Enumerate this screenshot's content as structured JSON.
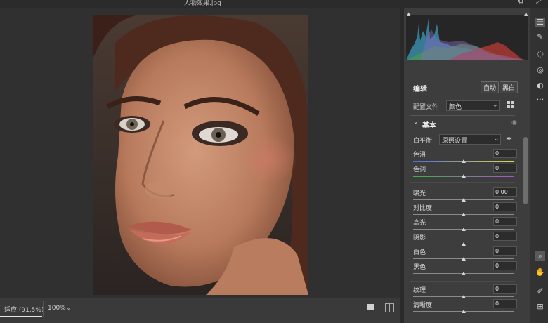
{
  "window": {
    "filename": "人物效果.jpg"
  },
  "canvas": {
    "fit_label": "适应 (91.5%)",
    "zoom_label": "100%",
    "zoom_chevron": "⌄"
  },
  "panel": {
    "edit_title": "编辑",
    "auto_button": "自动",
    "bw_button": "黑白",
    "profile_label": "配置文件",
    "profile_value": "颜色",
    "basic_title": "基本",
    "white_balance_label": "白平衡",
    "white_balance_value": "原照设置",
    "sliders": [
      {
        "label": "色温",
        "value": "0",
        "level": 0.5
      },
      {
        "label": "色调",
        "value": "0",
        "level": 0.5
      },
      {
        "label": "曝光",
        "value": "0.00",
        "level": 0.5
      },
      {
        "label": "对比度",
        "value": "0",
        "level": 0.5
      },
      {
        "label": "高光",
        "value": "0",
        "level": 0.5
      },
      {
        "label": "阴影",
        "value": "0",
        "level": 0.5
      },
      {
        "label": "白色",
        "value": "0",
        "level": 0.5
      },
      {
        "label": "黑色",
        "value": "0",
        "level": 0.5
      },
      {
        "label": "纹理",
        "value": "0",
        "level": 0.5
      },
      {
        "label": "清晰度",
        "value": "0",
        "level": 0.5
      }
    ]
  },
  "icons": {
    "gear": "settings-gear-icon",
    "expand": "expand-icon",
    "tools": [
      "edit-sliders-icon",
      "healing-brush-icon",
      "mask-icon",
      "red-eye-icon",
      "presets-icon",
      "more-icon",
      "zoom-icon",
      "hand-icon",
      "color-sampler-icon",
      "grid-overlay-icon"
    ]
  },
  "colors": {
    "accent_track_temp_start": "#4f6fd8",
    "accent_track_temp_end": "#e0d64a",
    "accent_track_tint_start": "#3fb04a",
    "accent_track_tint_end": "#b04fd0",
    "panel_bg": "#3d3d3d"
  }
}
